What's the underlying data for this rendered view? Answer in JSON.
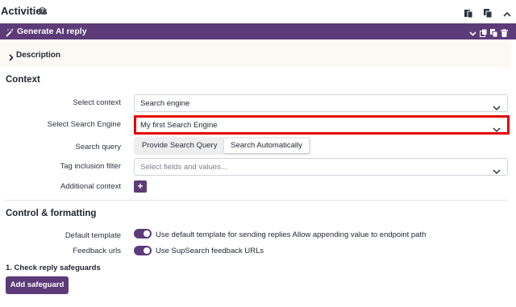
{
  "header": {
    "title": "Activities",
    "help_glyph": "?"
  },
  "icons": {
    "paste": "paste-icon",
    "copy": "copy-icon",
    "collapse": "chevron-up-icon"
  },
  "activity_bar": {
    "label": "Generate AI reply",
    "icon": "magic-wand-icon",
    "tools": [
      "chevron-down-icon",
      "duplicate-icon",
      "copy-icon",
      "trash-icon"
    ]
  },
  "description": {
    "label": "Description"
  },
  "context": {
    "title": "Context",
    "select_context": {
      "label": "Select context",
      "value": "Search engine"
    },
    "select_engine": {
      "label": "Select Search Engine",
      "value": "My first Search Engine"
    },
    "search_query": {
      "label": "Search query",
      "options": [
        "Provide Search Query",
        "Search Automatically"
      ],
      "selected": "Search Automatically"
    },
    "tag_filter": {
      "label": "Tag inclusion filter",
      "placeholder": "Select fields and values..."
    },
    "additional": {
      "label": "Additional context",
      "button": "+"
    }
  },
  "control": {
    "title": "Control & formatting",
    "default_template": {
      "label": "Default template",
      "text": "Use default template for sending replies Allow appending value to endpoint path",
      "on": true
    },
    "feedback_urls": {
      "label": "Feedback urls",
      "text": "Use SupSearch feedback URLs",
      "on": true
    }
  },
  "safeguards": {
    "title": "1. Check reply safeguards",
    "button": "Add safeguard"
  },
  "colors": {
    "accent": "#5d3a78",
    "highlight": "#e60000"
  }
}
